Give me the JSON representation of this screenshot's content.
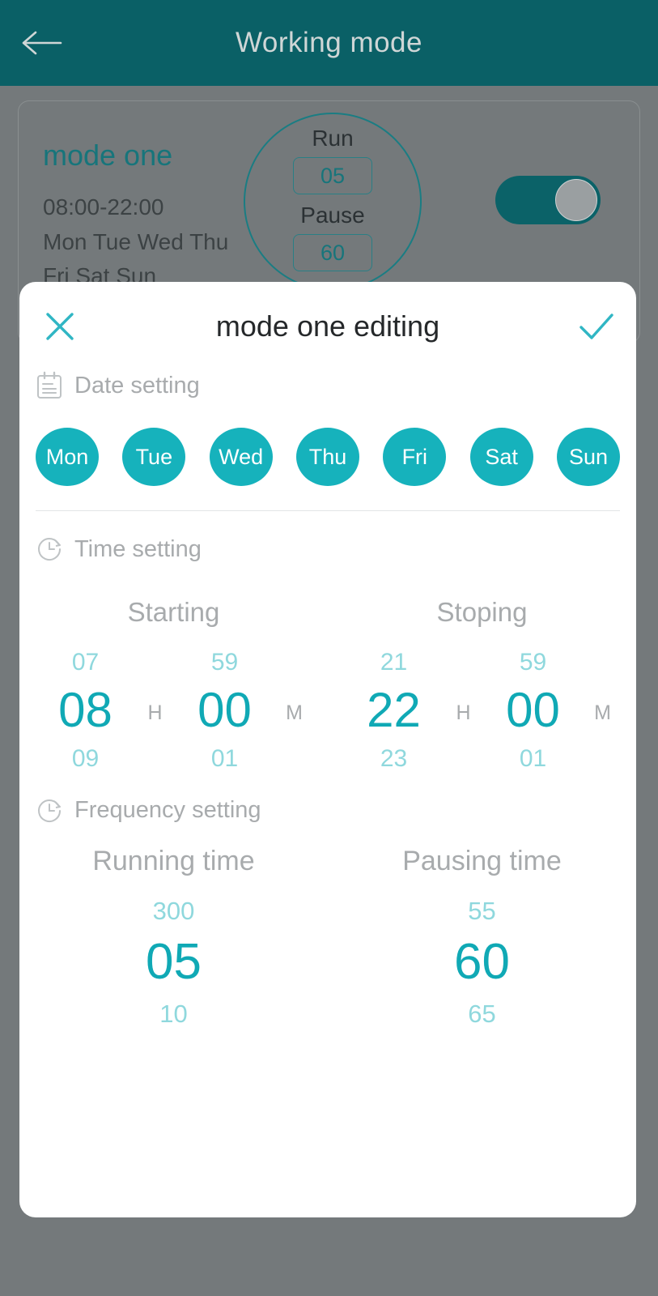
{
  "appbar": {
    "title": "Working mode",
    "back_icon": "back-arrow-icon"
  },
  "background_card": {
    "mode_name": "mode one",
    "time_range": "08:00-22:00",
    "days_line_1": "Mon Tue Wed Thu",
    "days_line_2": "Fri Sat Sun",
    "run_label": "Run",
    "run_value": "05",
    "pause_label": "Pause",
    "pause_value": "60",
    "toggle_state": "on"
  },
  "sheet": {
    "title": "mode one editing",
    "close_icon": "close-icon",
    "confirm_icon": "check-icon",
    "date_section": {
      "icon": "calendar-icon",
      "label": "Date setting",
      "days": [
        {
          "label": "Mon",
          "selected": true
        },
        {
          "label": "Tue",
          "selected": true
        },
        {
          "label": "Wed",
          "selected": true
        },
        {
          "label": "Thu",
          "selected": true
        },
        {
          "label": "Fri",
          "selected": true
        },
        {
          "label": "Sat",
          "selected": true
        },
        {
          "label": "Sun",
          "selected": true
        }
      ]
    },
    "time_section": {
      "icon": "clock-icon",
      "label": "Time setting",
      "starting_label": "Starting",
      "stoping_label": "Stoping",
      "starting": {
        "hour": {
          "prev": "07",
          "current": "08",
          "next": "09",
          "unit": "H"
        },
        "minute": {
          "prev": "59",
          "current": "00",
          "next": "01",
          "unit": "M"
        }
      },
      "stoping": {
        "hour": {
          "prev": "21",
          "current": "22",
          "next": "23",
          "unit": "H"
        },
        "minute": {
          "prev": "59",
          "current": "00",
          "next": "01",
          "unit": "M"
        }
      }
    },
    "frequency_section": {
      "icon": "clock-icon",
      "label": "Frequency setting",
      "running_label": "Running time",
      "pausing_label": "Pausing time",
      "running": {
        "prev": "300",
        "current": "05",
        "next": "10"
      },
      "pausing": {
        "prev": "55",
        "current": "60",
        "next": "65"
      }
    }
  },
  "colors": {
    "appbar_bg": "#0a6066",
    "accent_teal": "#16b2bc",
    "accent_dark_teal": "#10a9b5",
    "ghost_teal": "#8fd8dd",
    "overlay_gray": "#74797b",
    "muted_text": "#a8abad"
  }
}
